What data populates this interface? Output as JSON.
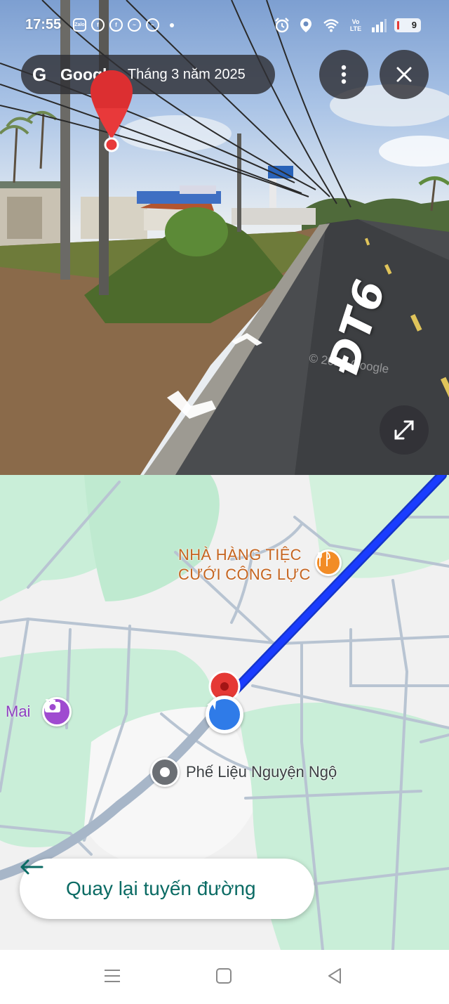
{
  "status_bar": {
    "time": "17:55",
    "app_icons": [
      "zalo-icon",
      "facebook-icon",
      "facebook-icon",
      "messenger-icon",
      "messenger-icon"
    ],
    "zalo_label": "Zalo",
    "network": "Vo LTE",
    "battery": "9"
  },
  "street_view": {
    "brand": "Google",
    "separator": "·",
    "date": "Tháng 3 năm 2025",
    "road_name": "ĐT6",
    "copyright": "© 2025 Google"
  },
  "map": {
    "restaurant": {
      "line1": "NHÀ HÀNG TIỆC",
      "line2": "CƯỚI CÔNG LỰC"
    },
    "photo_place": "Mai",
    "scrap_place": "Phế Liệu Nguyện Ngộ",
    "colors": {
      "route": "#1a3cff",
      "green_area": "#c9eed8",
      "road": "#aebccc"
    }
  },
  "back_to_route": {
    "label": "Quay lại tuyến đường"
  },
  "system_nav": {
    "buttons": [
      "menu-icon",
      "home-icon",
      "back-icon"
    ]
  }
}
